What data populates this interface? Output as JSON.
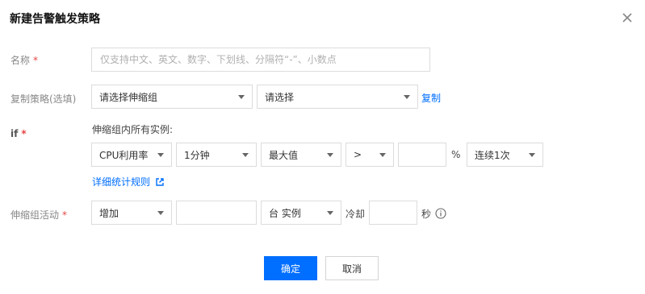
{
  "dialog": {
    "title": "新建告警触发策略"
  },
  "name_row": {
    "label": "名称",
    "required": "*",
    "placeholder": "仅支持中文、英文、数字、下划线、分隔符“-”、小数点"
  },
  "copy_row": {
    "label": "复制策略(选填)",
    "group_select": "请选择伸缩组",
    "policy_select": "请选择",
    "copy_link": "复制"
  },
  "if_row": {
    "label": "if",
    "required": "*",
    "desc": "伸缩组内所有实例:",
    "metric": "CPU利用率",
    "period": "1分钟",
    "statistic": "最大值",
    "operator": ">",
    "threshold_value": "",
    "unit": "%",
    "continuous": "连续1次",
    "rules_link": "详细统计规则"
  },
  "action_row": {
    "label": "伸缩组活动",
    "required": "*",
    "action": "增加",
    "count_value": "",
    "count_unit": "台 实例",
    "cooldown_label": "冷却",
    "cooldown_value": "",
    "seconds_label": "秒"
  },
  "footer": {
    "confirm": "确定",
    "cancel": "取消"
  },
  "colors": {
    "primary": "#006eff",
    "required": "#e54545"
  }
}
